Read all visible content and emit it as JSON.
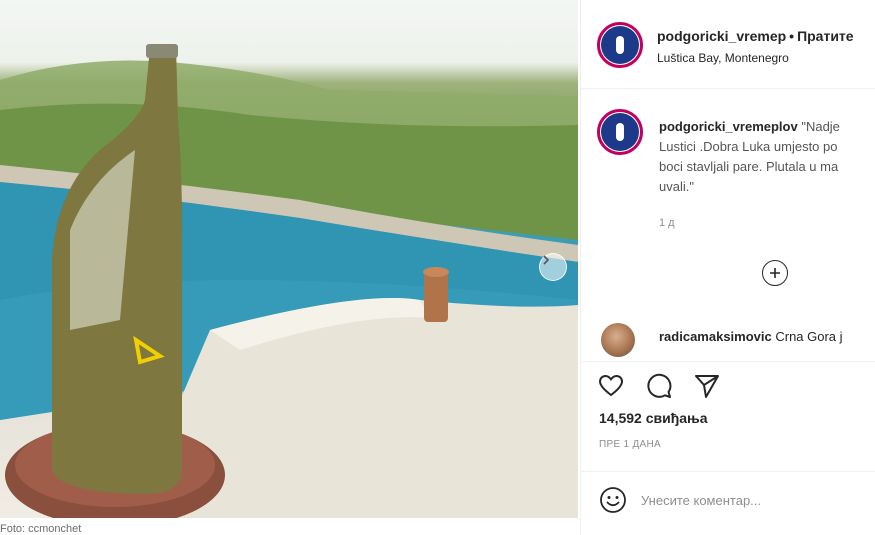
{
  "photo": {
    "caption": "Foto: ccmonchet"
  },
  "header": {
    "username": "podgoricki_vremep",
    "dot": "•",
    "follow_label": "Пратите",
    "location": "Luštica Bay, Montenegro"
  },
  "post": {
    "username": "podgoricki_vremeplov",
    "caption_line1": " \"Nadje",
    "caption_line2": "Lustici .Dobra Luka umjesto po",
    "caption_line3": "boci stavljali pare. Plutala u ma",
    "caption_line4": "uvali.\"",
    "time": "1 д"
  },
  "reply": {
    "username": "radicamaksimovic",
    "text": " Crna Gora j"
  },
  "stats": {
    "likes": "14,592 свиђања",
    "posted_ago": "ПРЕ 1 ДАНА"
  },
  "comment_box": {
    "placeholder": "Унесите коментар..."
  },
  "icons": {
    "like": "heart-icon",
    "comment": "comment-icon",
    "share": "send-icon",
    "more": "plus-circle-icon",
    "emoji": "emoji-icon",
    "next": "chevron-right-icon"
  },
  "colors": {
    "avatar_ring": "#c4005c",
    "avatar_fill": "#1d3a8a",
    "muted": "#8e8e8e"
  }
}
